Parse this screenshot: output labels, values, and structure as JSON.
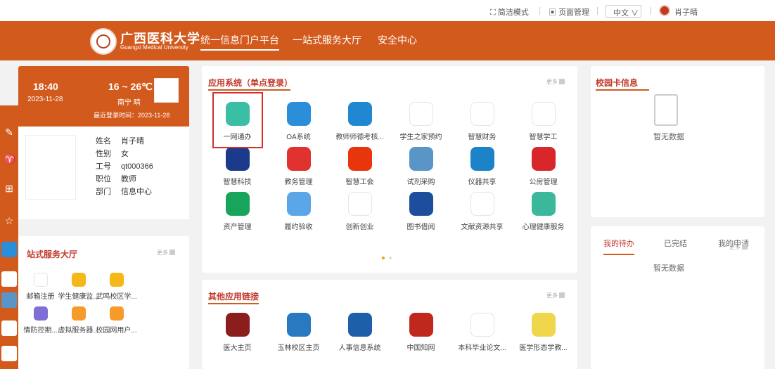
{
  "top": {
    "simple_mode": "简洁模式",
    "page_manage": "页面管理",
    "lang": "中文 ∨",
    "user": "肖子晴"
  },
  "nav": {
    "logo_cn": "广西医科大学",
    "logo_en": "Guangxi Medical University",
    "items": [
      "统一信息门户平台",
      "一站式服务大厅",
      "安全中心"
    ]
  },
  "weather": {
    "time": "18:40",
    "date": "2023-11-28",
    "temp": "16 ~ 26℃",
    "city": "南宁 晴",
    "last_login": "最近登录时间：2023-11-28"
  },
  "user": {
    "name_k": "姓名",
    "name_v": "肖子晴",
    "gender_k": "性别",
    "gender_v": "女",
    "id_k": "工号",
    "id_v": "qt000366",
    "role_k": "职位",
    "role_v": "教师",
    "dept_k": "部门",
    "dept_v": "信息中心"
  },
  "apps": {
    "title": "应用系统（单点登录）",
    "more": "更多",
    "items": [
      {
        "label": "一网通办",
        "color": "#3bbfa4",
        "icon": "paper-plane-icon"
      },
      {
        "label": "OA系统",
        "color": "#2a8ed8",
        "icon": "oa-icon"
      },
      {
        "label": "教师师德考核...",
        "color": "#1f88d0",
        "icon": "card-icon"
      },
      {
        "label": "学生之家预约",
        "color": "#ffffff",
        "icon": "swirl-icon"
      },
      {
        "label": "智慧财务",
        "color": "#ffffff",
        "icon": "spiral-icon"
      },
      {
        "label": "智慧学工",
        "color": "#ffffff",
        "icon": "book-icon"
      },
      {
        "label": "智慧科技",
        "color": "#1b3a8c",
        "icon": "seal-icon"
      },
      {
        "label": "教务管理",
        "color": "#e0322e",
        "icon": "graduation-icon"
      },
      {
        "label": "智慧工会",
        "color": "#e8350c",
        "icon": "union-icon"
      },
      {
        "label": "试剂采购",
        "color": "#5a95c7",
        "icon": "lab-icon"
      },
      {
        "label": "仪器共享",
        "color": "#1c83c8",
        "icon": "microscope-icon"
      },
      {
        "label": "公房管理",
        "color": "#d8262b",
        "icon": "house-icon"
      },
      {
        "label": "资产管理",
        "color": "#18a45a",
        "icon": "asset-icon"
      },
      {
        "label": "履约验收",
        "color": "#5aa6e8",
        "icon": "finder-icon"
      },
      {
        "label": "创新创业",
        "color": "#ffffff",
        "icon": "innovation-icon"
      },
      {
        "label": "图书借阅",
        "color": "#1d4e9e",
        "icon": "library-icon"
      },
      {
        "label": "文献资源共享",
        "color": "#ffffff",
        "icon": "carsi-icon"
      },
      {
        "label": "心理健康服务",
        "color": "#3bb89a",
        "icon": "heart-icon"
      }
    ]
  },
  "card": {
    "title": "校园卡信息",
    "empty": "暂无数据"
  },
  "service": {
    "title": "站式服务大厅",
    "more": "更多",
    "items": [
      {
        "label": "邮箱注册",
        "color": "#ffffff"
      },
      {
        "label": "学生健康监...",
        "color": "#f5b81b"
      },
      {
        "label": "武鸣校区学...",
        "color": "#f5b81b"
      },
      {
        "label": "情防控期...",
        "color": "#7e6ed6"
      },
      {
        "label": "虚拟服务器...",
        "color": "#f59a2b"
      },
      {
        "label": "校园网用户...",
        "color": "#f59a2b"
      }
    ]
  },
  "todo": {
    "tabs": [
      "我的待办",
      "已完结",
      "我的申请"
    ],
    "more": "更多",
    "empty": "暂无数据"
  },
  "links": {
    "title": "其他应用链接",
    "more": "更多",
    "items": [
      {
        "label": "医大主页",
        "color": "#8b1d1d"
      },
      {
        "label": "玉林校区主页",
        "color": "#2979c0"
      },
      {
        "label": "人事信息系统",
        "color": "#1d5fa8"
      },
      {
        "label": "中国知网",
        "color": "#c0281e"
      },
      {
        "label": "本科毕业论文...",
        "color": "#ffffff"
      },
      {
        "label": "医学形态学教...",
        "color": "#f0d64a"
      }
    ]
  },
  "sidebar_icons": [
    "edit-icon",
    "shirt-icon",
    "plus-box-icon",
    "star-icon",
    "oa-mini-icon",
    "app-icon-1",
    "app-icon-2",
    "carsi-mini-icon",
    "book-mini-icon"
  ]
}
